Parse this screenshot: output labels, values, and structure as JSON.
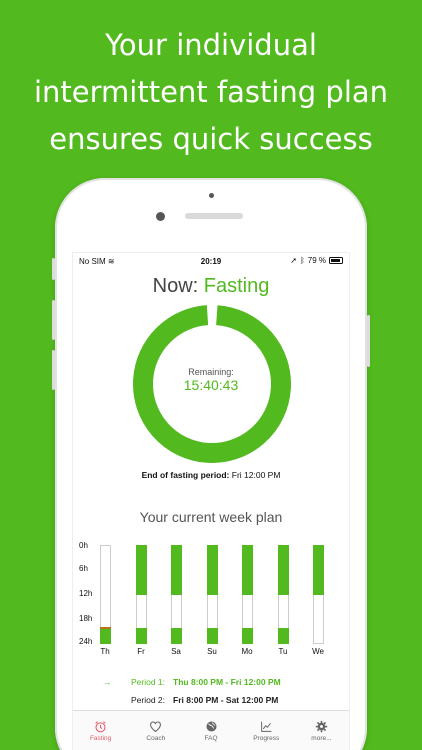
{
  "headline": [
    "Your individual",
    "intermittent fasting plan",
    "ensures quick success"
  ],
  "status_bar": {
    "carrier": "No SIM",
    "time": "20:19",
    "battery": "79 %"
  },
  "now": {
    "prefix": "Now:",
    "state": "Fasting"
  },
  "timer": {
    "label": "Remaining:",
    "value": "15:40:43"
  },
  "end_period": {
    "label": "End of fasting period:",
    "value": "Fri 12:00 PM"
  },
  "week_plan_title": "Your current week plan",
  "y_axis": [
    "0h",
    "6h",
    "12h",
    "18h",
    "24h"
  ],
  "days": [
    "Th",
    "Fr",
    "Sa",
    "Su",
    "Mo",
    "Tu",
    "We"
  ],
  "periods": [
    {
      "label": "Period 1:",
      "value": "Thu 8:00 PM  -  Fri 12:00 PM",
      "active": true
    },
    {
      "label": "Period 2:",
      "value": "Fri 8:00 PM  -  Sat 12:00 PM",
      "active": false
    }
  ],
  "tabs": [
    {
      "label": "Fasting",
      "icon": "alarm-clock-icon",
      "active": true
    },
    {
      "label": "Coach",
      "icon": "heart-icon",
      "active": false
    },
    {
      "label": "FAQ",
      "icon": "globe-icon",
      "active": false
    },
    {
      "label": "Progress",
      "icon": "chart-icon",
      "active": false
    },
    {
      "label": "more...",
      "icon": "gear-icon",
      "active": false
    }
  ],
  "colors": {
    "brand_green": "#52b91f",
    "tab_active": "#e45a67"
  }
}
